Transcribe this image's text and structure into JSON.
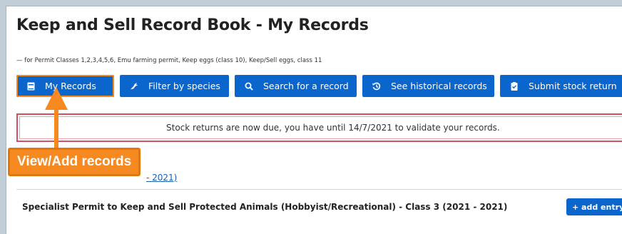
{
  "page": {
    "title": "Keep and Sell Record Book - My Records",
    "subtitle": "— for Permit Classes 1,2,3,4,5,6, Emu farming permit, Keep eggs (class 10), Keep/Sell eggs, class 11"
  },
  "nav": {
    "my_records": "My Records",
    "filter_species": "Filter by species",
    "search_record": "Search for a record",
    "historical": "See historical records",
    "submit_return": "Submit stock return"
  },
  "alert": {
    "text": "Stock returns are now due, you have until 14/7/2021 to validate your records."
  },
  "callout": {
    "text": "View/Add records"
  },
  "partial_link": "- 2021)",
  "permit": {
    "title": "Specialist Permit to Keep and Sell Protected Animals (Hobbyist/Recreational) - Class 3 (2021 - 2021)",
    "add_label": "+ add entry"
  },
  "colors": {
    "primary": "#0a66cc",
    "alert_border": "#d34f5c",
    "callout": "#f6891f"
  },
  "icons": [
    "book-icon",
    "bird-icon",
    "search-icon",
    "history-icon",
    "clipboard-check-icon"
  ]
}
